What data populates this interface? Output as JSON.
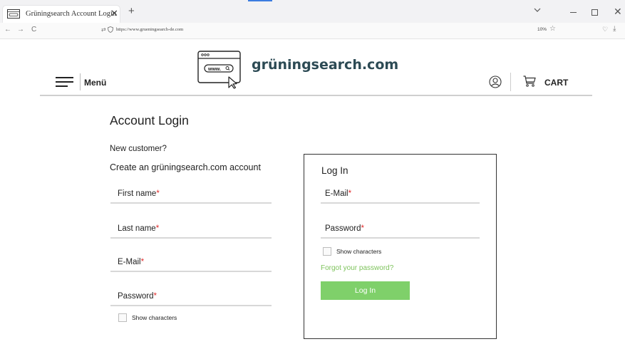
{
  "browser": {
    "tab_title": "Grüningsearch Account Login",
    "tab_close": "✕",
    "new_tab": "+",
    "url": "https://www.grueningsearch-de.com",
    "zoom": "10%",
    "nav_back": "←",
    "nav_forward": "→",
    "nav_reload": "C",
    "tracking_glyph": "⇄",
    "star_glyph": "☆",
    "pocket_glyph": "♡",
    "download_glyph": "⤓",
    "close_glyph": "✕",
    "icons": [
      "favicon-icon",
      "back-arrow-icon",
      "forward-arrow-icon",
      "reload-icon",
      "tracking-protection-icon",
      "shield-icon",
      "bookmark-star-icon",
      "pocket-icon",
      "download-icon",
      "tab-list-chevron-icon",
      "minimize-icon",
      "maximize-icon",
      "close-window-icon"
    ],
    "accent_color": "#3c7ce0"
  },
  "header": {
    "menu_label": "Menü",
    "logo_text": "grüningsearch.com",
    "logo_icon_text": "www.",
    "cart_label": "CART",
    "icons": [
      "hamburger-menu-icon",
      "browser-window-logo-icon",
      "cursor-arrow-icon",
      "user-account-icon",
      "shopping-cart-icon"
    ]
  },
  "page": {
    "title": "Account Login",
    "new_customer": "New customer?",
    "create_account": "Create an grüningsearch.com account"
  },
  "register": {
    "first_name": "First name",
    "last_name": "Last name",
    "email": "E-Mail",
    "password": "Password",
    "required_marker": "*",
    "show_characters": "Show characters"
  },
  "login": {
    "title": "Log In",
    "email": "E-Mail",
    "password": "Password",
    "required_marker": "*",
    "show_characters": "Show characters",
    "forgot": "Forgot your password?",
    "button": "Log In"
  },
  "colors": {
    "brand_text": "#2c4a54",
    "login_button": "#7fd06a",
    "link_green": "#7dc35b",
    "required_red": "#e02b2b"
  }
}
